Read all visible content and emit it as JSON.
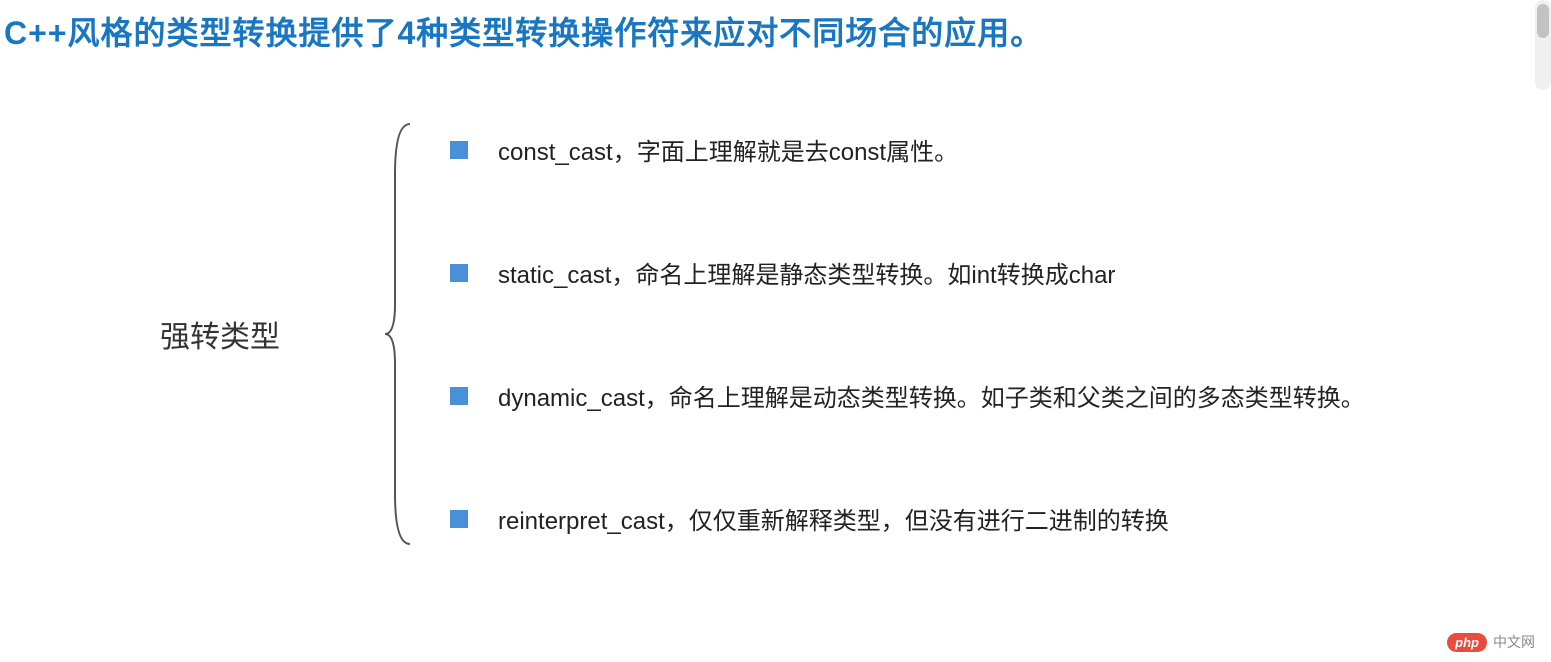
{
  "heading": "C++风格的类型转换提供了4种类型转换操作符来应对不同场合的应用。",
  "category_label": "强转类型",
  "items": [
    "const_cast，字面上理解就是去const属性。",
    "static_cast，命名上理解是静态类型转换。如int转换成char",
    "dynamic_cast，命名上理解是动态类型转换。如子类和父类之间的多态类型转换。",
    "reinterpret_cast，仅仅重新解释类型，但没有进行二进制的转换"
  ],
  "watermark": {
    "badge": "php",
    "text": "中文网"
  }
}
